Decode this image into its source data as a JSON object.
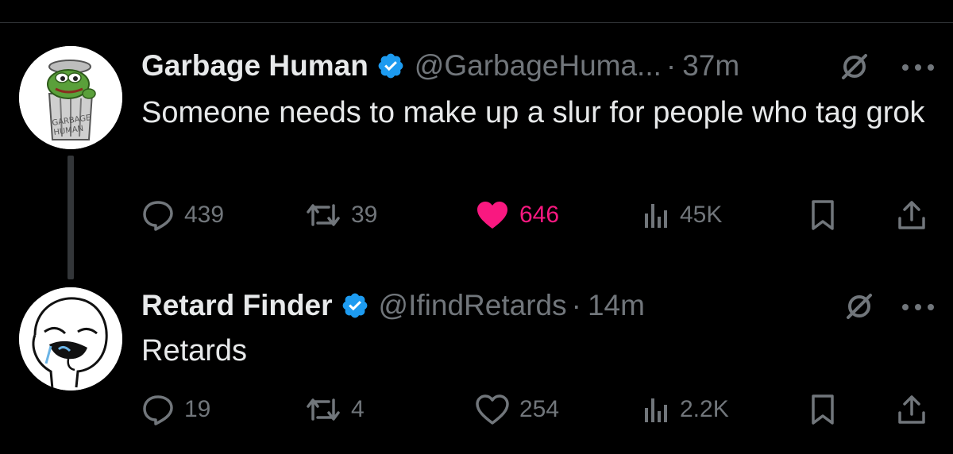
{
  "tweets": [
    {
      "display_name": "Garbage Human",
      "handle": "@GarbageHuma...",
      "separator": "·",
      "time": "37m",
      "text": "Someone needs to make up a slur for people who tag grok",
      "avatar_icon": "pepe-in-trash-can-avatar",
      "avatar_lettering": "GARBAGE HUMAN",
      "stats": {
        "replies": "439",
        "reposts": "39",
        "likes": "646",
        "views": "45K"
      },
      "liked": true
    },
    {
      "display_name": "Retard Finder",
      "handle": "@IfindRetards",
      "separator": "·",
      "time": "14m",
      "text": "Retards",
      "avatar_icon": "meme-face-sketch-avatar",
      "stats": {
        "replies": "19",
        "reposts": "4",
        "likes": "254",
        "views": "2.2K"
      },
      "liked": false
    }
  ],
  "colors": {
    "background": "#000000",
    "text_primary": "#e7e9ea",
    "text_secondary": "#71767b",
    "verified_blue": "#1d9bf0",
    "like_pink": "#f91880",
    "thread_line": "#333639"
  }
}
